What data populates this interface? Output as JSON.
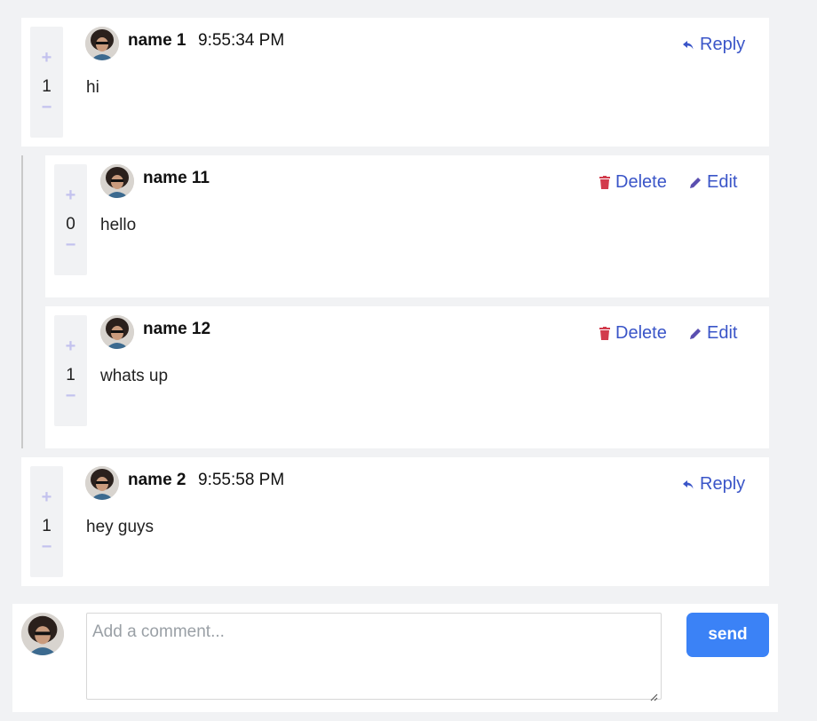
{
  "comments": [
    {
      "votes": "1",
      "name": "name 1",
      "time": "9:55:34 PM",
      "text": "hi",
      "actions": [
        "Reply"
      ]
    },
    {
      "votes": "0",
      "name": "name 11",
      "time": "",
      "text": "hello",
      "actions": [
        "Delete",
        "Edit"
      ]
    },
    {
      "votes": "1",
      "name": "name 12",
      "time": "",
      "text": "whats up",
      "actions": [
        "Delete",
        "Edit"
      ]
    },
    {
      "votes": "1",
      "name": "name 2",
      "time": "9:55:58 PM",
      "text": "hey guys",
      "actions": [
        "Reply"
      ]
    }
  ],
  "vote_plus": "+",
  "vote_minus": "−",
  "composer": {
    "placeholder": "Add a comment...",
    "send_label": "send"
  },
  "colors": {
    "accent": "#3a55c8",
    "danger": "#d23b4c",
    "send_button": "#3b82f6",
    "vote_icon": "#c3c2ee"
  },
  "icons": {
    "reply": "reply-arrow-icon",
    "delete": "trash-icon",
    "edit": "pencil-icon"
  }
}
